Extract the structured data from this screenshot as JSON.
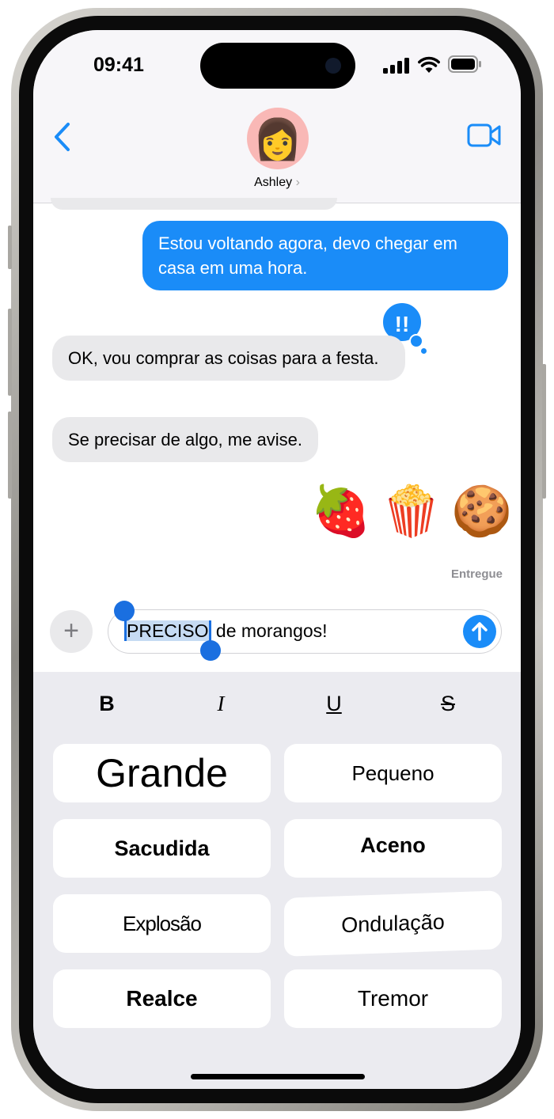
{
  "status_bar": {
    "time": "09:41"
  },
  "header": {
    "contact_name": "Ashley",
    "chevron": "›",
    "icons": [
      "back-chevron-icon",
      "video-camera-icon"
    ]
  },
  "messages": [
    {
      "direction": "outgoing",
      "text": "Estou voltando agora, devo chegar em casa em uma hora."
    },
    {
      "direction": "incoming",
      "text": "OK, vou comprar as coisas para a festa.",
      "tapback": "!!"
    },
    {
      "direction": "incoming",
      "text": "Se precisar de algo, me avise."
    },
    {
      "direction": "outgoing",
      "emojis": [
        "🍓",
        "🍿",
        "🍪"
      ]
    }
  ],
  "delivery_status": "Entregue",
  "composer": {
    "selected_text": "PRECISO",
    "rest_text": " de morangos!",
    "plus_label": "+",
    "send_icon": "arrow-up-icon"
  },
  "formatting": {
    "bold": "B",
    "italic": "I",
    "underline": "U",
    "strikethrough": "S"
  },
  "effects": [
    "Grande",
    "Pequeno",
    "Sacudida",
    "Aceno",
    "Explosão",
    "Ondulação",
    "Realce",
    "Tremor"
  ],
  "colors": {
    "accent": "#1a8cf8",
    "incoming_bubble": "#e9e9eb",
    "keyboard_bg": "#ebebf0"
  }
}
